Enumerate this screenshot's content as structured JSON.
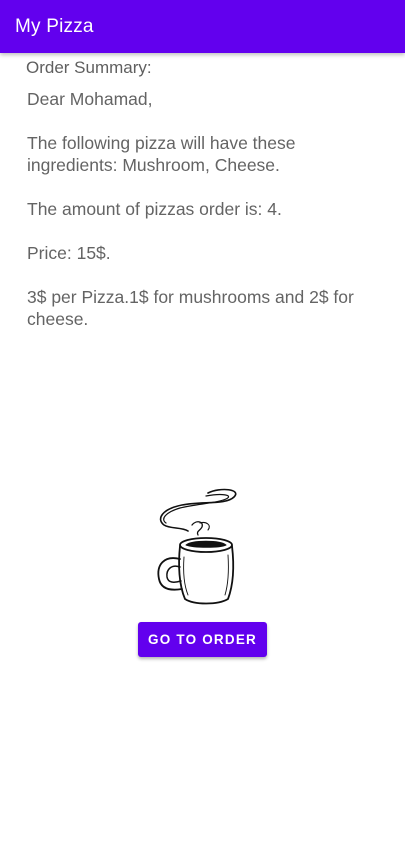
{
  "app_bar": {
    "title": "My Pizza",
    "color": "#6200ee"
  },
  "summary": {
    "heading": "Order Summary:",
    "greeting": "Dear Mohamad,",
    "ingredients_line": "The following pizza will have these ingredients: Mushroom, Cheese.",
    "amount_line": "The amount of pizzas order is: 4.",
    "price_line": "Price: 15$.",
    "pricing_note": "3$ per Pizza.1$ for mushrooms and 2$ for cheese."
  },
  "illustration": {
    "icon": "coffee-mug-icon"
  },
  "actions": {
    "go_to_order_label": "GO TO ORDER",
    "button_color": "#6200ee"
  }
}
